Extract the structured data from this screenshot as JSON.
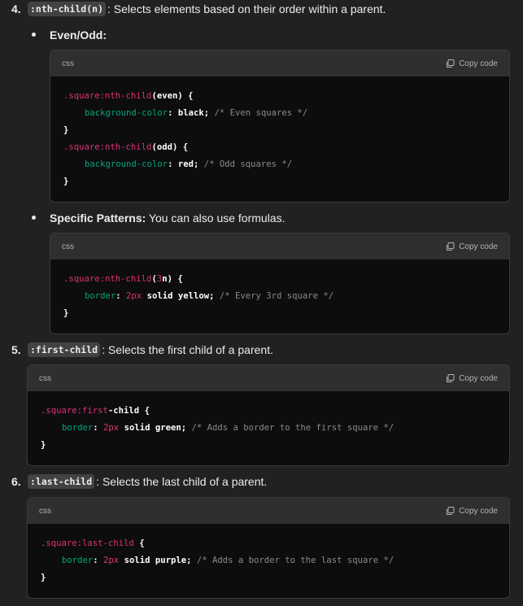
{
  "item4": {
    "number": "4.",
    "code": ":nth-child(n)",
    "text": ": Selects elements based on their order within a parent.",
    "bullet1": {
      "label": "Even/Odd:",
      "block": {
        "lang": "css",
        "copy": "Copy code",
        "l1_sel": ".square:nth-child",
        "l1_arg": "(even) {",
        "l2_prop": "background-color",
        "l2_colon": ": ",
        "l2_val": "black;",
        "l2_cm": " /* Even squares */",
        "l3": "}",
        "l4_sel": ".square:nth-child",
        "l4_arg": "(odd) {",
        "l5_prop": "background-color",
        "l5_colon": ": ",
        "l5_val": "red;",
        "l5_cm": " /* Odd squares */",
        "l6": "}"
      }
    },
    "bullet2": {
      "label": "Specific Patterns:",
      "text": " You can also use formulas.",
      "block": {
        "lang": "css",
        "copy": "Copy code",
        "l1_sel": ".square:nth-child",
        "l1_p": "(",
        "l1_n": "3",
        "l1_rest": "n) {",
        "l2_prop": "border",
        "l2_colon": ": ",
        "l2_num": "2px",
        "l2_val": " solid yellow;",
        "l2_cm": " /* Every 3rd square */",
        "l3": "}"
      }
    }
  },
  "item5": {
    "number": "5.",
    "code": ":first-child",
    "text": ": Selects the first child of a parent.",
    "block": {
      "lang": "css",
      "copy": "Copy code",
      "l1_sel": ".square:first",
      "l1_rest": "-child {",
      "l2_prop": "border",
      "l2_colon": ": ",
      "l2_num": "2px",
      "l2_val": " solid green;",
      "l2_cm": " /* Adds a border to the first square */",
      "l3": "}"
    }
  },
  "item6": {
    "number": "6.",
    "code": ":last-child",
    "text": ": Selects the last child of a parent.",
    "block": {
      "lang": "css",
      "copy": "Copy code",
      "l1_sel": ".square:last-child",
      "l1_rest": " {",
      "l2_prop": "border",
      "l2_colon": ": ",
      "l2_num": "2px",
      "l2_val": " solid purple;",
      "l2_cm": " /* Adds a border to the last square */",
      "l3": "}"
    }
  },
  "icons": {
    "copy": "copy-icon"
  }
}
